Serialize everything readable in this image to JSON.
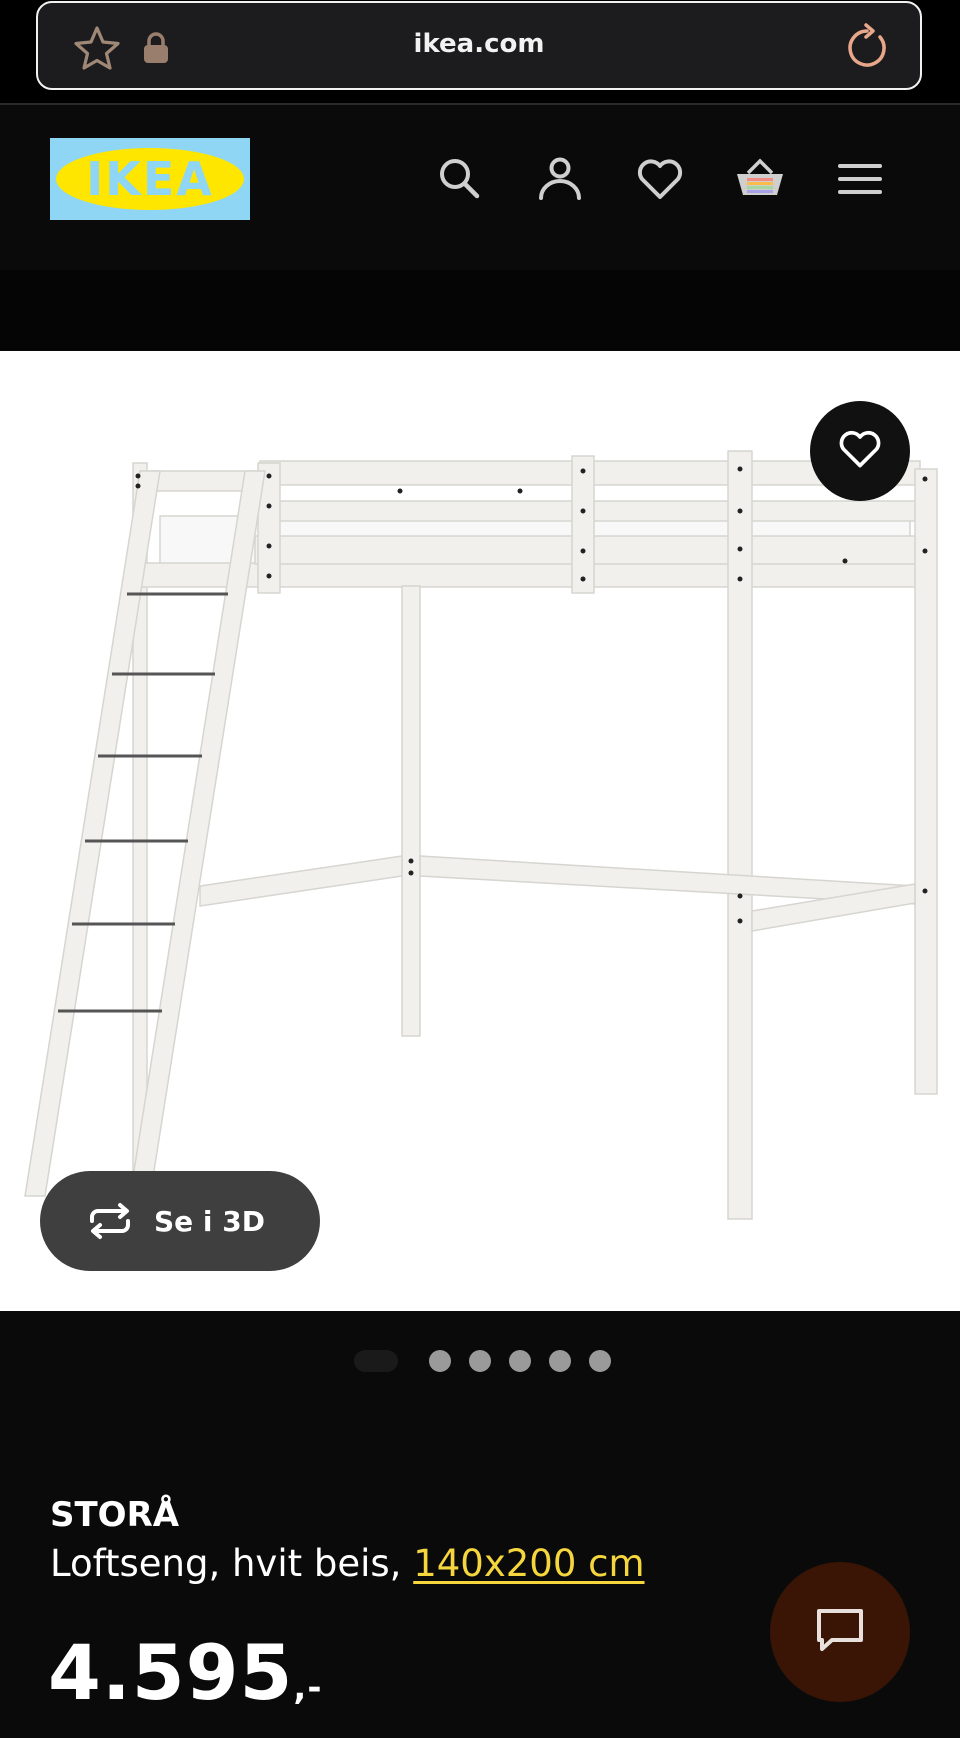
{
  "browser": {
    "url": "ikea.com",
    "icons": [
      "star-icon",
      "lock-icon",
      "reload-icon"
    ]
  },
  "header": {
    "logo_text": "IKEA",
    "icons": [
      "search-icon",
      "account-icon",
      "heart-icon",
      "cart-icon",
      "menu-icon"
    ]
  },
  "gallery": {
    "view_3d_label": "Se i 3D",
    "slide_count": 6,
    "active_slide": 1
  },
  "product": {
    "name": "STORÅ",
    "description_prefix": "Loftseng, hvit beis, ",
    "size_link": "140x200 cm",
    "price": "4.595",
    "price_suffix": ",-"
  },
  "colors": {
    "background": "#0a0a0b",
    "link": "#f5d63d",
    "logo_blue": "#8ed6f4",
    "logo_yellow": "#ffe600",
    "chat_bg": "#3a1505"
  }
}
